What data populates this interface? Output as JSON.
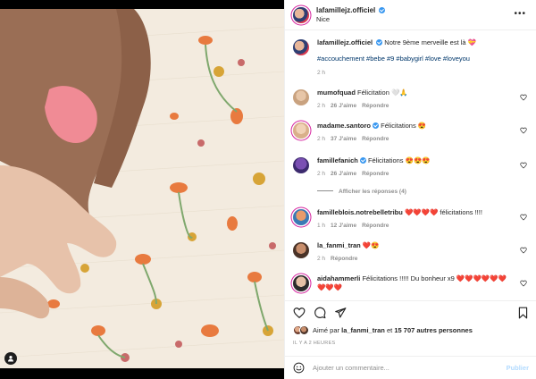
{
  "header": {
    "username": "lafamillejz.officiel",
    "location": "Nice",
    "more_icon": "more-horizontal-icon"
  },
  "caption": {
    "username": "lafamillejz.officiel",
    "text": "Notre 9ème merveille est là 💝",
    "hashtags": "#accouchement #bebe #9 #babygirl #love #loveyou",
    "time": "2 h"
  },
  "comments": [
    {
      "username": "mumofquad",
      "text": "Félicitation 🤍🙏",
      "time": "2 h",
      "likes": "26 J'aime",
      "reply": "Répondre",
      "verified": false
    },
    {
      "username": "madame.santoro",
      "text": "Félicitations 😍",
      "time": "2 h",
      "likes": "37 J'aime",
      "reply": "Répondre",
      "verified": true
    },
    {
      "username": "famillefanich",
      "text": "Félicitations 😍😍😍",
      "time": "2 h",
      "likes": "26 J'aime",
      "reply": "Répondre",
      "verified": true
    },
    {
      "username": "familleblois.notrebelletribu",
      "text": "❤️❤️❤️❤️ félicitations !!!!",
      "time": "1 h",
      "likes": "12 J'aime",
      "reply": "Répondre",
      "verified": false
    },
    {
      "username": "la_fanmi_tran",
      "text": "❤️😍",
      "time": "2 h",
      "likes": "",
      "reply": "Répondre",
      "verified": false
    },
    {
      "username": "aidahammerli",
      "text": "Félicitations !!!!! Du bonheur x9 ❤️❤️❤️❤️❤️❤️❤️❤️❤️",
      "time": "",
      "likes": "",
      "reply": "",
      "verified": false
    }
  ],
  "show_replies": "Afficher les réponses (4)",
  "likes": {
    "prefix": "Aimé par",
    "user": "la_fanmi_tran",
    "middle": "et",
    "count": "15 707 autres personnes"
  },
  "time_ago": "IL Y A 2 HEURES",
  "add_comment": {
    "placeholder": "Ajouter un commentaire...",
    "publish_label": "Publier"
  },
  "colors": {
    "verified": "#3897f0",
    "meta": "#8e8e8e",
    "hashtag": "#00376b",
    "publish_disabled": "#b3dbff"
  }
}
